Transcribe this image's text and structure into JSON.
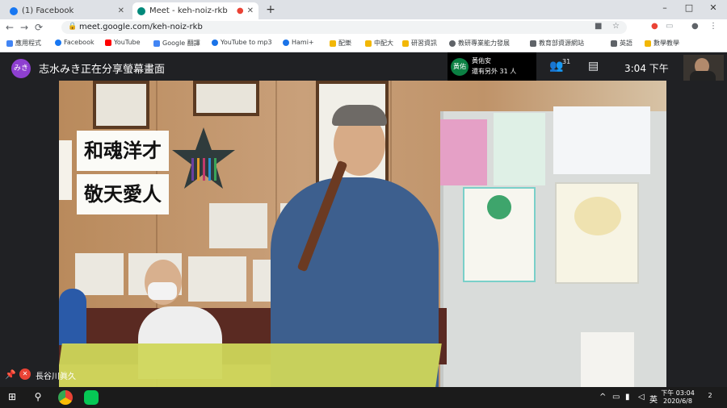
{
  "browser": {
    "tabs": [
      {
        "title": "(1) Facebook",
        "favicon_color": "#1877f2"
      },
      {
        "title": "Meet - keh-noiz-rkb",
        "favicon_color": "#00897b"
      }
    ],
    "new_tab_label": "+",
    "window_controls": [
      "–",
      "□",
      "✕"
    ],
    "url": "meet.google.com/keh-noiz-rkb",
    "bookmarks": [
      {
        "label": "應用程式",
        "color": "#4285f4"
      },
      {
        "label": "Facebook",
        "color": "#1877f2"
      },
      {
        "label": "YouTube",
        "color": "#ff0000"
      },
      {
        "label": "Google 翻譯",
        "color": "#4285f4"
      },
      {
        "label": "YouTube to mp3",
        "color": "#1a73e8"
      },
      {
        "label": "Hami+",
        "color": "#1a73e8"
      },
      {
        "label": "配樂",
        "color": "#f2b705"
      },
      {
        "label": "中配大",
        "color": "#f2b705"
      },
      {
        "label": "研習資訊",
        "color": "#f2b705"
      },
      {
        "label": "教研專業能力發展",
        "color": "#5f6368"
      },
      {
        "label": "教育部資源網站",
        "color": "#5f6368"
      },
      {
        "label": "英語",
        "color": "#5f6368"
      },
      {
        "label": "數學教學",
        "color": "#f2b705"
      }
    ]
  },
  "meet": {
    "presenter_initials": "みき",
    "presenter_text": "志水みき正在分享螢幕畫面",
    "pip": {
      "initials": "黃佑安",
      "name": "黃佑安",
      "others": "還有另外 31 人"
    },
    "people_count": "31",
    "time": "3:04 下午",
    "speaker_name": "長谷川眞久",
    "colors": {
      "accent_presenter": "#8e3fd0",
      "accent_pip": "#0b8043",
      "mic_off": "#ea4335"
    }
  },
  "scene": {
    "banner_line1": "和魂洋才",
    "banner_line2": "敬天愛人"
  },
  "taskbar": {
    "time": "下午 03:04",
    "date": "2020/6/8",
    "notifications": "2"
  }
}
